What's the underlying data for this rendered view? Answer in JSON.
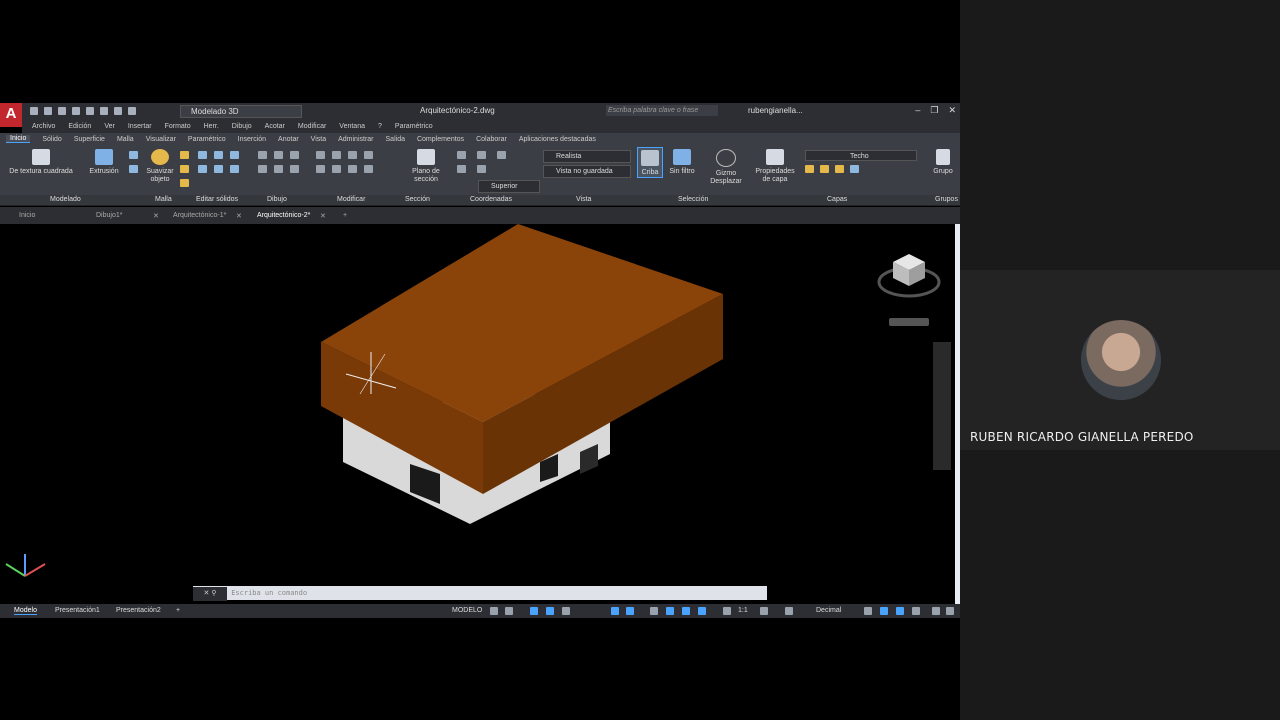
{
  "participant": {
    "name": "RUBEN RICARDO GIANELLA PEREDO"
  },
  "titlebar": {
    "logo": "A",
    "workspace": "Modelado 3D",
    "document": "Arquitectónico-2.dwg",
    "search_placeholder": "Escriba palabra clave o frase",
    "user": "rubengianella..."
  },
  "menu": [
    "Archivo",
    "Edición",
    "Ver",
    "Insertar",
    "Formato",
    "Herr.",
    "Dibujo",
    "Acotar",
    "Modificar",
    "Ventana",
    "?",
    "Paramétrico"
  ],
  "ribbon_tabs": [
    "Inicio",
    "Sólido",
    "Superficie",
    "Malla",
    "Visualizar",
    "Paramétrico",
    "Inserción",
    "Anotar",
    "Vista",
    "Administrar",
    "Salida",
    "Complementos",
    "Colaborar",
    "Aplicaciones destacadas"
  ],
  "ribbon": {
    "box_label": "De textura cuadrada",
    "extrude_label": "Extrusión",
    "smooth_label": "Suavizar objeto",
    "section_plane_label": "Plano de sección",
    "visual_style": "Realista",
    "view": "Vista no guardada",
    "ucs": "Superior",
    "culling_label": "Criba",
    "filter_label": "Sin filtro",
    "gizmo_label": "Gizmo Desplazar",
    "layer_props_label": "Propiedades de capa",
    "layer": "Techo",
    "group_label": "Grupo"
  },
  "panel_labels": [
    "Modelado",
    "Malla",
    "Editar sólidos",
    "Dibujo",
    "Modificar",
    "Sección",
    "Coordenadas",
    "Vista",
    "Selección",
    "Capas",
    "Grupos"
  ],
  "doc_tabs": [
    "Inicio",
    "Dibujo1*",
    "Arquitectónico-1*",
    "Arquitectónico-2*"
  ],
  "command": {
    "placeholder": "Escriba un comando"
  },
  "layout_tabs": [
    "Modelo",
    "Presentación1",
    "Presentación2"
  ],
  "status": {
    "mode": "MODELO",
    "scale": "1:1",
    "units": "Decimal"
  },
  "colors": {
    "roof": "#7a3a07",
    "walls": "#d9d9d9",
    "accent": "#4aa3ff",
    "logo": "#c1272d"
  }
}
